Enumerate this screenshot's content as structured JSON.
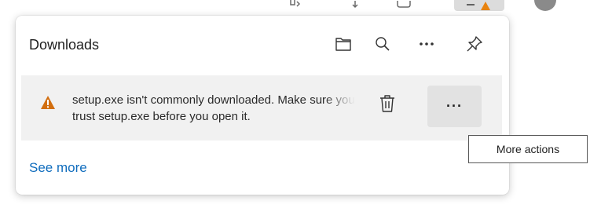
{
  "toolbar": {
    "icons": [
      "extensions-icon",
      "favorites-icon",
      "collections-icon",
      "downloads-warning-icon",
      "profile-avatar"
    ]
  },
  "downloads_panel": {
    "title": "Downloads",
    "header_buttons": {
      "open_folder_icon": "folder-icon",
      "search_icon": "search-icon",
      "more_options_icon": "ellipsis-icon",
      "pin_icon": "pin-icon"
    },
    "item": {
      "warning_icon": "warning-triangle-icon",
      "message_line1": "setup.exe isn't commonly downloaded. Make sure you",
      "message_line2": "trust setup.exe before you open it.",
      "delete_icon": "trash-icon",
      "more_actions_label": "···"
    },
    "see_more_label": "See more"
  },
  "tooltip": {
    "text": "More actions"
  },
  "colors": {
    "panel_bg": "#ffffff",
    "item_bg": "#f1f1f1",
    "more_button_bg": "#e2e2e2",
    "warning_triangle": "#d26e0f",
    "link": "#0f6cbd",
    "text": "#1f1f1f"
  }
}
